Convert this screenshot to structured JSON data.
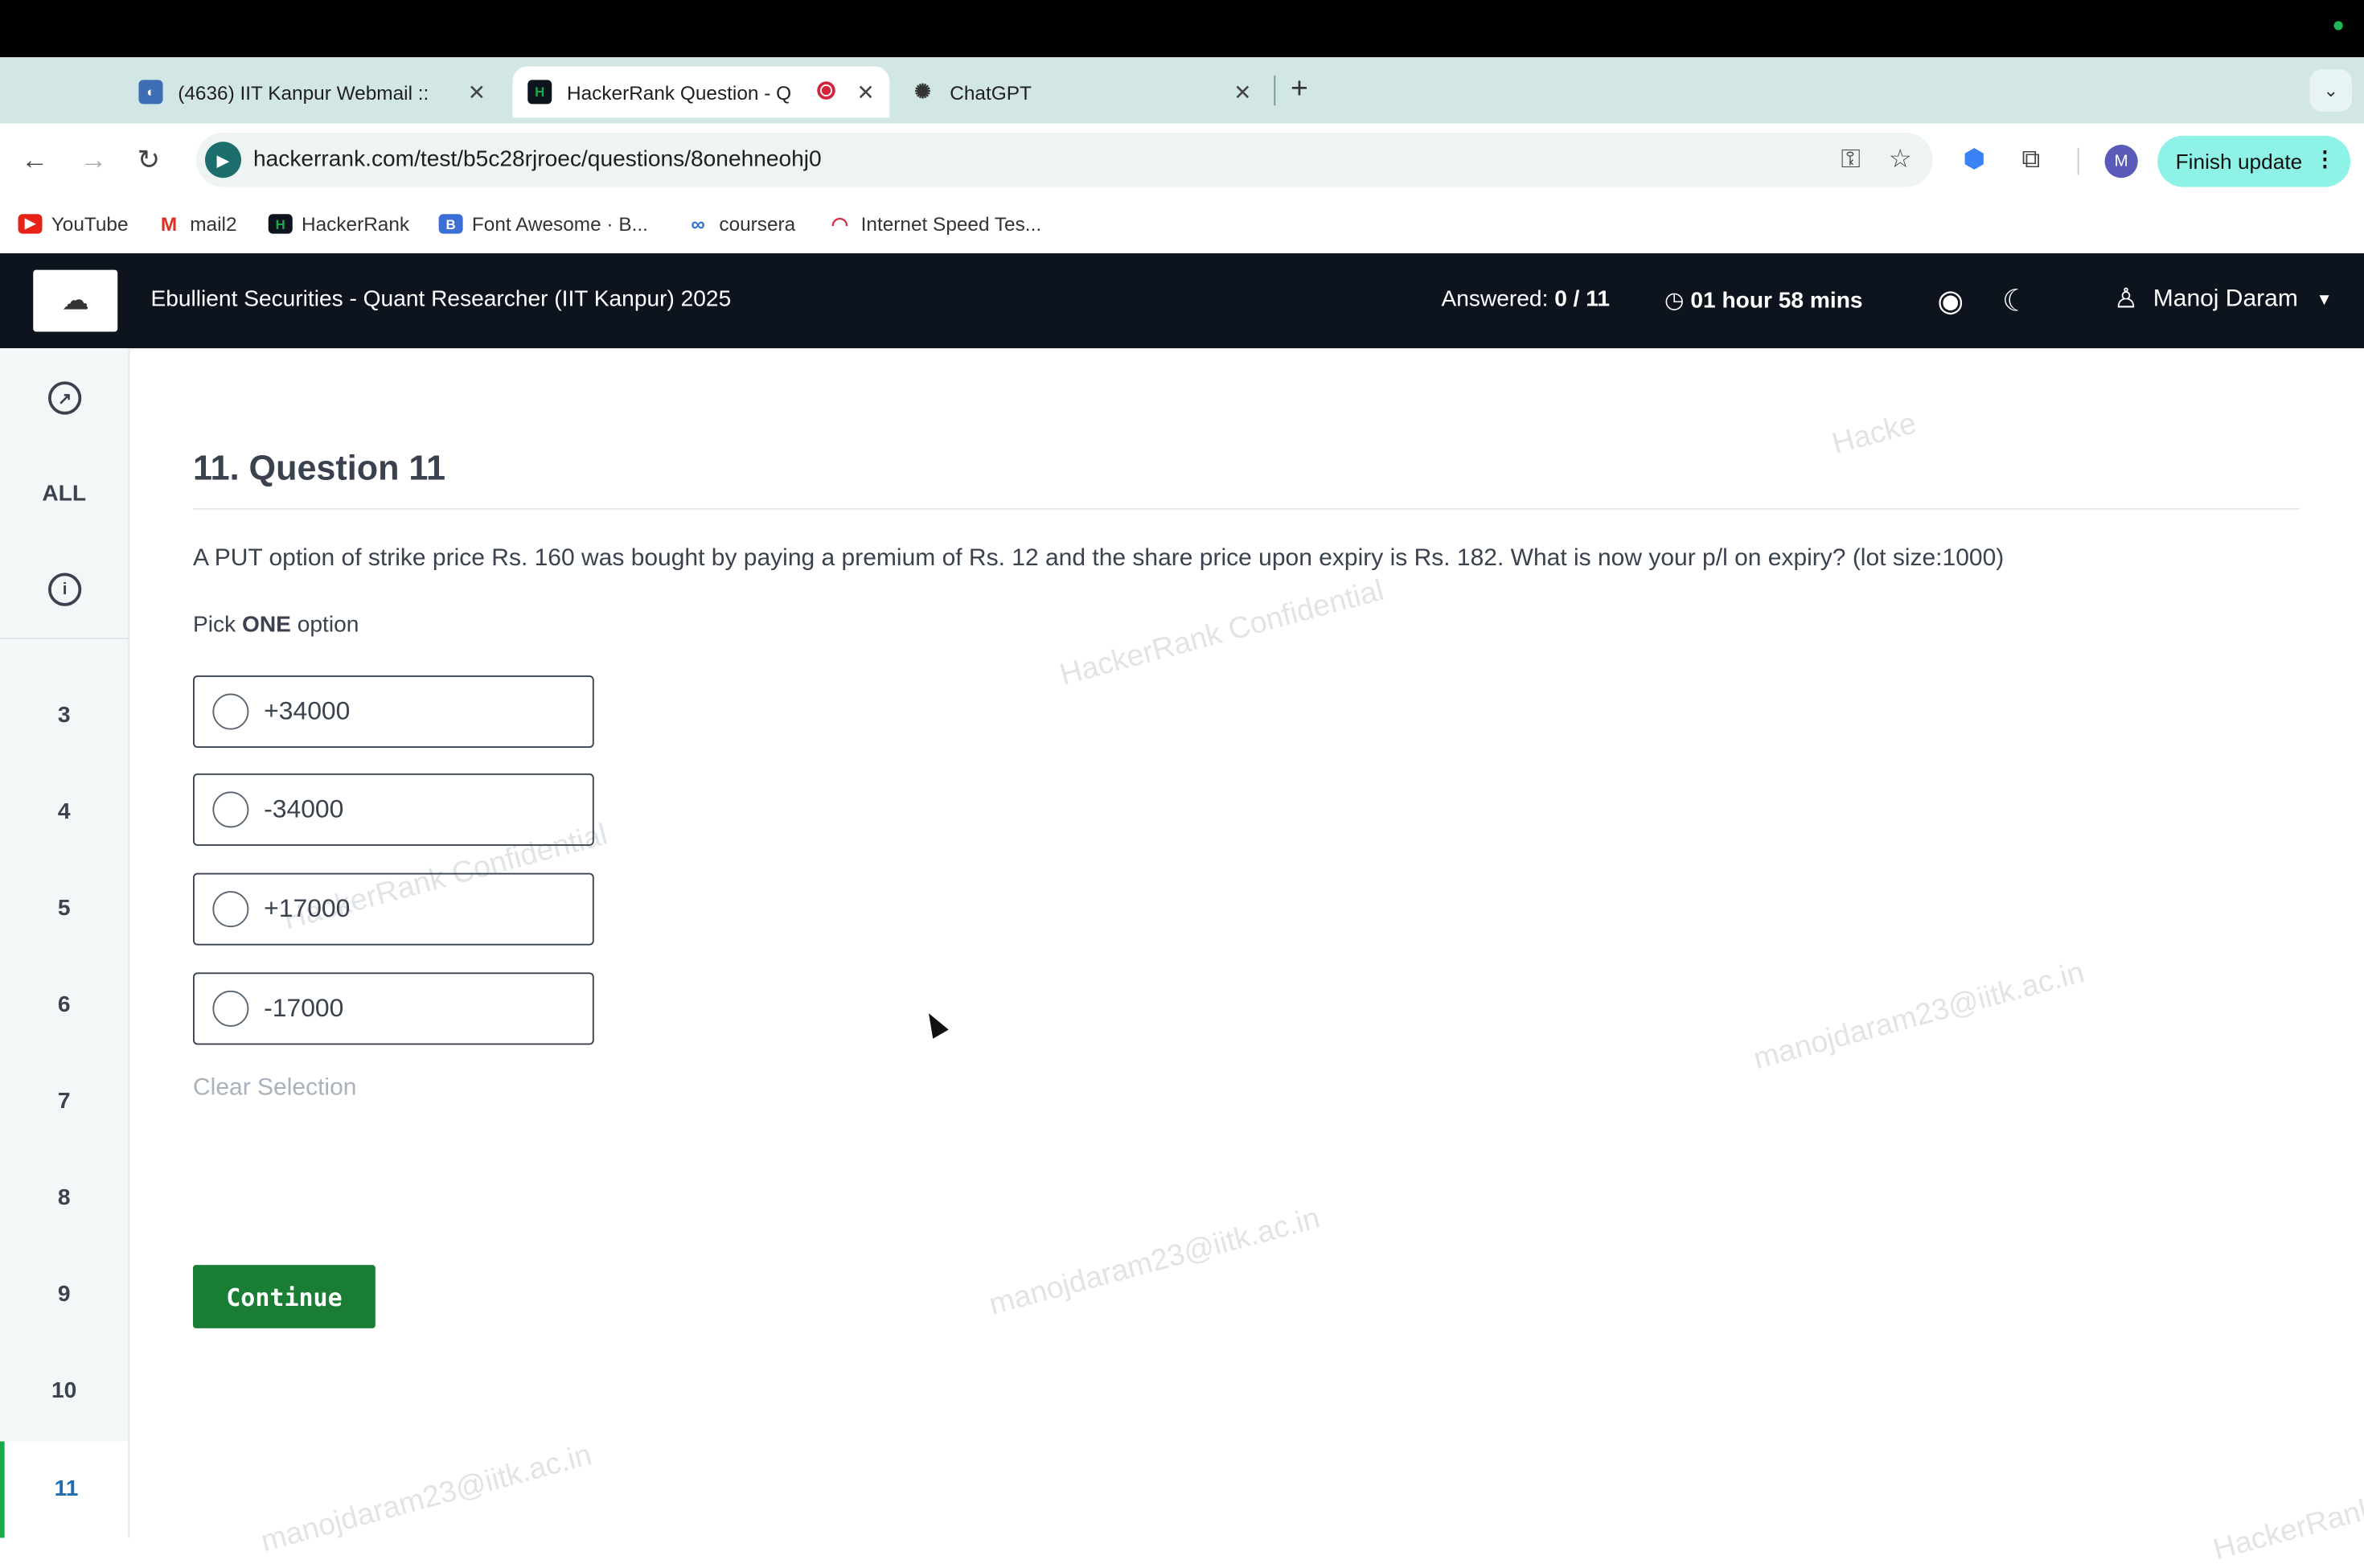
{
  "browser": {
    "tabs": [
      {
        "title": "(4636) IIT Kanpur Webmail ::",
        "icon": "webmail-icon"
      },
      {
        "title": "HackerRank Question - Q",
        "icon": "hackerrank-icon",
        "recording": true
      },
      {
        "title": "ChatGPT",
        "icon": "chatgpt-icon"
      }
    ],
    "url": "hackerrank.com/test/b5c28rjroec/questions/8onehneohj0",
    "avatar_letter": "M",
    "finish_update_label": "Finish update",
    "bookmarks": [
      {
        "label": "YouTube",
        "icon": "youtube-icon"
      },
      {
        "label": "mail2",
        "icon": "gmail-icon"
      },
      {
        "label": "HackerRank",
        "icon": "hackerrank-icon"
      },
      {
        "label": "Font Awesome · B...",
        "icon": "bootstrap-icon"
      },
      {
        "label": "coursera",
        "icon": "coursera-icon"
      },
      {
        "label": "Internet Speed Tes...",
        "icon": "speedtest-icon"
      }
    ]
  },
  "header": {
    "test_name": "Ebullient Securities - Quant Researcher (IIT Kanpur) 2025",
    "answered_label": "Answered:",
    "answered_value": "0 / 11",
    "timer": "01 hour 58 mins",
    "user_name": "Manoj Daram"
  },
  "sidebar": {
    "all_label": "ALL",
    "items": [
      "3",
      "4",
      "5",
      "6",
      "7",
      "8",
      "9",
      "10",
      "11"
    ],
    "active": "11"
  },
  "question": {
    "title": "11. Question 11",
    "text": "A PUT option of strike price Rs. 160 was bought by paying a premium of Rs. 12 and the share price upon expiry is Rs. 182. What is now your p/l on expiry? (lot size:1000)",
    "pick_prefix": "Pick ",
    "pick_bold": "ONE",
    "pick_suffix": " option",
    "options": [
      "+34000",
      "-34000",
      "+17000",
      "-17000"
    ],
    "clear_label": "Clear Selection",
    "continue_label": "Continue"
  },
  "watermarks": [
    "HackerRank Confidential",
    "manojdaram23@iitk.ac.in"
  ]
}
